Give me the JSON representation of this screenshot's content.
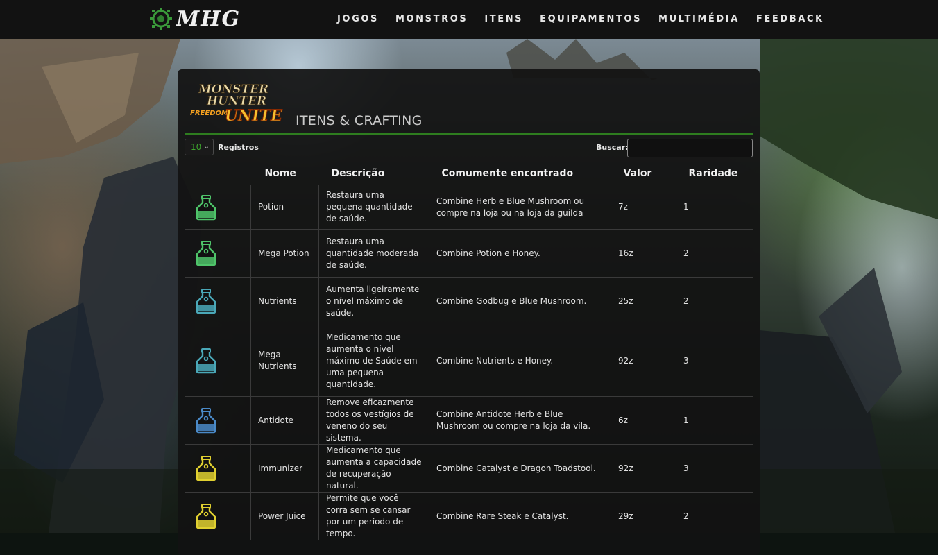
{
  "site": {
    "logo_text": "MHG",
    "nav": [
      "JOGOS",
      "MONSTROS",
      "ITENS",
      "EQUIPAMENTOS",
      "MULTIMÉDIA",
      "FEEDBACK"
    ]
  },
  "page": {
    "game_logo_lines": [
      "MONSTER",
      "HUNTER",
      "FREEDOM",
      "UNITE"
    ],
    "section_title": "ITENS & CRAFTING"
  },
  "controls": {
    "length_value": "10",
    "length_label": "Registros",
    "search_label": "Buscar:",
    "search_value": ""
  },
  "table": {
    "headers": [
      "",
      "Nome",
      "Descrição",
      "Comumente encontrado",
      "Valor",
      "Raridade"
    ],
    "rows": [
      {
        "icon": "potion-bottle-icon",
        "color": "#4fc46a",
        "name": "Potion",
        "description": "Restaura uma pequena quantidade de saúde.",
        "found": "Combine Herb e Blue Mushroom ou compre na loja ou na loja da guilda",
        "value": "7z",
        "rarity": "1"
      },
      {
        "icon": "mega-potion-bottle-icon",
        "color": "#4fc46a",
        "name": "Mega Potion",
        "description": "Restaura uma quantidade moderada de saúde.",
        "found": "Combine Potion e Honey.",
        "value": "16z",
        "rarity": "2"
      },
      {
        "icon": "nutrients-bottle-icon",
        "color": "#4aa8b8",
        "name": "Nutrients",
        "description": "Aumenta ligeiramente o nível máximo de saúde.",
        "found": "Combine Godbug e Blue Mushroom.",
        "value": "25z",
        "rarity": "2"
      },
      {
        "icon": "mega-nutrients-bottle-icon",
        "color": "#4aa8b8",
        "name": "Mega Nutrients",
        "description": "Medicamento que aumenta o nível máximo de Saúde em uma pequena quantidade.",
        "found": "Combine Nutrients e Honey.",
        "value": "92z",
        "rarity": "3"
      },
      {
        "icon": "antidote-bottle-icon",
        "color": "#4a8ac8",
        "name": "Antidote",
        "description": "Remove eficazmente todos os vestígios de veneno do seu sistema.",
        "found": "Combine Antidote Herb e Blue Mushroom ou compre na loja da vila.",
        "value": "6z",
        "rarity": "1"
      },
      {
        "icon": "immunizer-bottle-icon",
        "color": "#e0d030",
        "name": "Immunizer",
        "description": "Medicamento que aumenta a capacidade de recuperação natural.",
        "found": "Combine Catalyst e Dragon Toadstool.",
        "value": "92z",
        "rarity": "3"
      },
      {
        "icon": "power-juice-bottle-icon",
        "color": "#e0d030",
        "name": "Power Juice",
        "description": "Permite que você corra sem se cansar por um período de tempo.",
        "found": "Combine Rare Steak e Catalyst.",
        "value": "29z",
        "rarity": "2"
      }
    ]
  }
}
